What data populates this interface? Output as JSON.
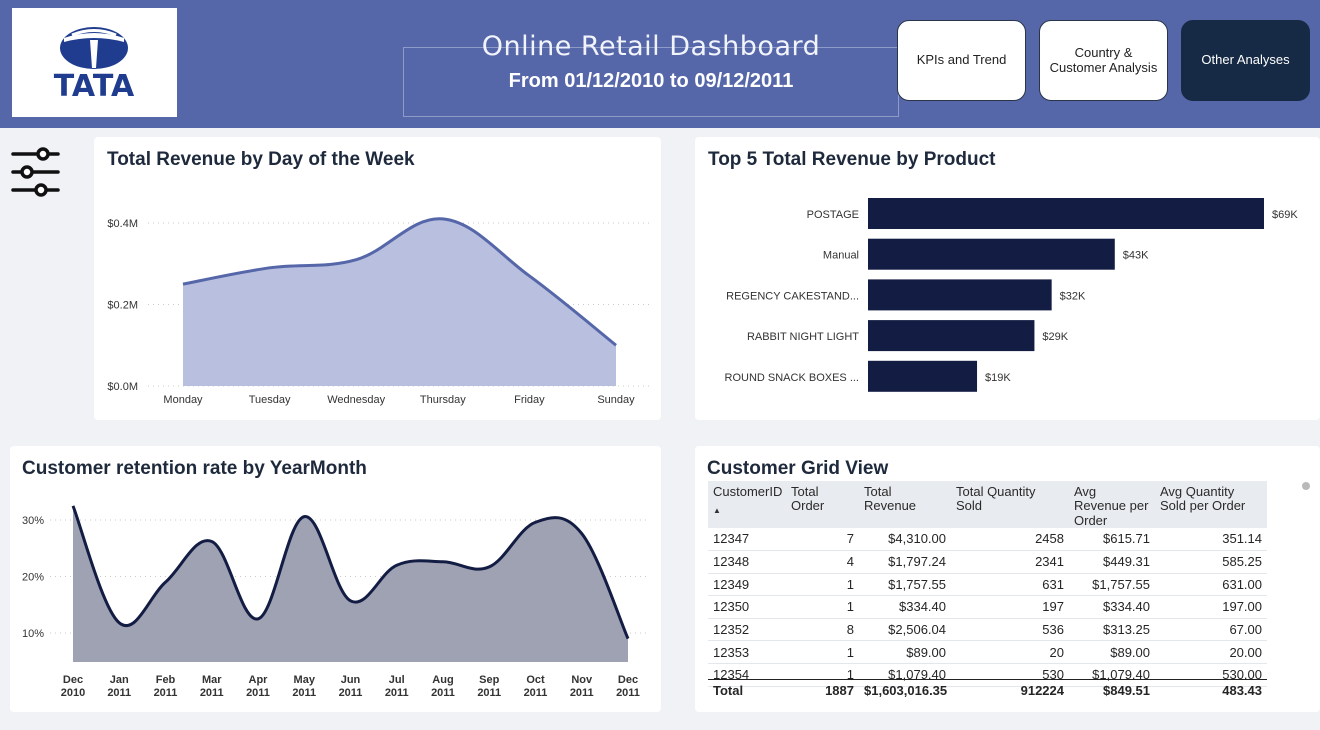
{
  "header": {
    "title": "Online Retail Dashboard",
    "subtitle": "From 01/12/2010 to 09/12/2011",
    "logo_text": "TATA",
    "nav_buttons": [
      {
        "label": "KPIs and Trend",
        "active": false
      },
      {
        "label": "Country & Customer Analysis",
        "active": false
      },
      {
        "label": "Other Analyses",
        "active": true
      }
    ]
  },
  "filter_icon": "sliders-filter-icon",
  "colors": {
    "header_bg": "#5566a9",
    "area_fill": "#b8bfdf",
    "area_line": "#5566a9",
    "bar": "#131c43",
    "retention_fill": "#9fa2b3",
    "retention_line": "#131c43",
    "active_button": "#162a45"
  },
  "chart_data": [
    {
      "type": "area",
      "title": "Total Revenue by Day of the Week",
      "categories": [
        "Monday",
        "Tuesday",
        "Wednesday",
        "Thursday",
        "Friday",
        "Sunday"
      ],
      "values": [
        0.25,
        0.29,
        0.31,
        0.41,
        0.27,
        0.1
      ],
      "y_ticks": [
        "$0.0M",
        "$0.2M",
        "$0.4M"
      ],
      "ylim": [
        0,
        0.4
      ],
      "grid": true
    },
    {
      "type": "bar",
      "orientation": "horizontal",
      "title": "Top 5 Total Revenue by Product",
      "categories": [
        "POSTAGE",
        "Manual",
        "REGENCY CAKESTAND...",
        "RABBIT NIGHT LIGHT",
        "ROUND SNACK BOXES ..."
      ],
      "values": [
        69,
        43,
        32,
        29,
        19
      ],
      "data_labels": [
        "$69K",
        "$43K",
        "$32K",
        "$29K",
        "$19K"
      ],
      "unit": "$K"
    },
    {
      "type": "area",
      "title": "Customer retention rate by YearMonth",
      "categories": [
        {
          "month": "Dec",
          "year": "2010"
        },
        {
          "month": "Jan",
          "year": "2011"
        },
        {
          "month": "Feb",
          "year": "2011"
        },
        {
          "month": "Mar",
          "year": "2011"
        },
        {
          "month": "Apr",
          "year": "2011"
        },
        {
          "month": "May",
          "year": "2011"
        },
        {
          "month": "Jun",
          "year": "2011"
        },
        {
          "month": "Jul",
          "year": "2011"
        },
        {
          "month": "Aug",
          "year": "2011"
        },
        {
          "month": "Sep",
          "year": "2011"
        },
        {
          "month": "Oct",
          "year": "2011"
        },
        {
          "month": "Nov",
          "year": "2011"
        },
        {
          "month": "Dec",
          "year": "2011"
        }
      ],
      "values": [
        32.5,
        11.8,
        19.0,
        26.2,
        12.5,
        30.6,
        15.7,
        22.0,
        22.6,
        21.7,
        29.6,
        27.6,
        9.0
      ],
      "y_ticks": [
        "10%",
        "20%",
        "30%"
      ],
      "y_tick_values": [
        10,
        20,
        30
      ],
      "ylim": [
        5,
        35
      ],
      "grid": true
    },
    {
      "type": "table",
      "title": "Customer Grid View",
      "columns": [
        "CustomerID",
        "Total Order",
        "Total Revenue",
        "Total Quantity Sold",
        "Avg Revenue per Order",
        "Avg Quantity Sold per Order"
      ],
      "sort_indicator": "▲",
      "rows": [
        [
          "12347",
          "7",
          "$4,310.00",
          "2458",
          "$615.71",
          "351.14"
        ],
        [
          "12348",
          "4",
          "$1,797.24",
          "2341",
          "$449.31",
          "585.25"
        ],
        [
          "12349",
          "1",
          "$1,757.55",
          "631",
          "$1,757.55",
          "631.00"
        ],
        [
          "12350",
          "1",
          "$334.40",
          "197",
          "$334.40",
          "197.00"
        ],
        [
          "12352",
          "8",
          "$2,506.04",
          "536",
          "$313.25",
          "67.00"
        ],
        [
          "12353",
          "1",
          "$89.00",
          "20",
          "$89.00",
          "20.00"
        ],
        [
          "12354",
          "1",
          "$1,079.40",
          "530",
          "$1,079.40",
          "530.00"
        ]
      ],
      "total": [
        "Total",
        "1887",
        "$1,603,016.35",
        "912224",
        "$849.51",
        "483.43"
      ]
    }
  ]
}
